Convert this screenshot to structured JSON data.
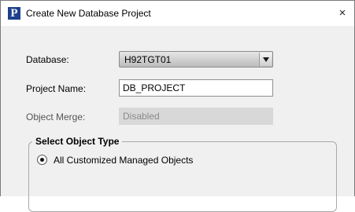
{
  "window": {
    "title": "Create New Database Project",
    "app_icon": "P",
    "close_icon": "×"
  },
  "form": {
    "database_label": "Database:",
    "database_value": "H92TGT01",
    "project_name_label": "Project Name:",
    "project_name_value": "DB_PROJECT",
    "object_merge_label": "Object Merge:",
    "object_merge_value": "Disabled"
  },
  "object_type": {
    "group_title": "Select Object Type",
    "options": [
      {
        "label": "All Customized Managed Objects",
        "selected": true
      }
    ]
  }
}
